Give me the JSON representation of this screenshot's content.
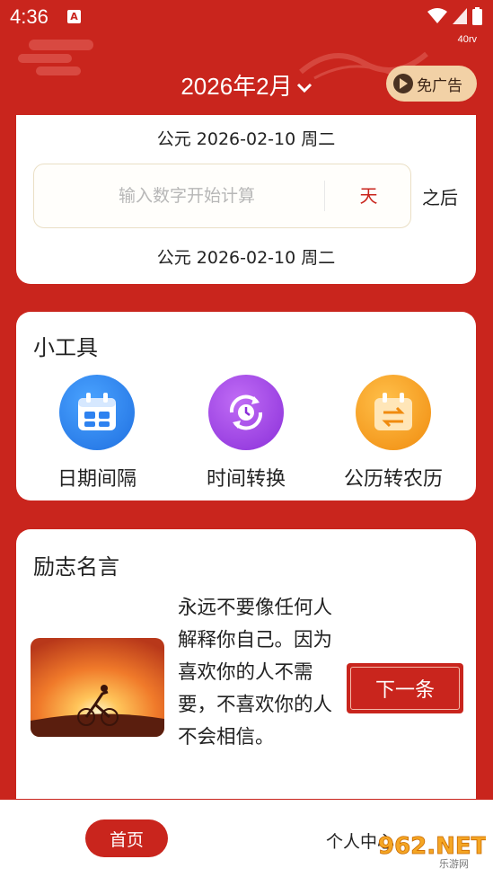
{
  "status_bar": {
    "time": "4:36",
    "app_badge": "A",
    "net_label": "40rv"
  },
  "header": {
    "month_title": "2026年2月",
    "ad_button_label": "免广告"
  },
  "calculator": {
    "date_top": "公元 2026-02-10 周二",
    "input_placeholder": "输入数字开始计算",
    "input_value": "",
    "unit_label": "天",
    "direction_label": "之后",
    "date_bottom": "公元 2026-02-10 周二"
  },
  "tools": {
    "title": "小工具",
    "items": [
      {
        "label": "日期间隔",
        "icon": "calendar-icon",
        "color": "#2e82f0"
      },
      {
        "label": "时间转换",
        "icon": "clock-convert-icon",
        "color": "#9c3ce3"
      },
      {
        "label": "公历转农历",
        "icon": "calendar-swap-icon",
        "color": "#f59a16"
      }
    ]
  },
  "quotes": {
    "title": "励志名言",
    "text": "永远不要像任何人解释你自己。因为喜欢你的人不需要，不喜欢你的人不会相信。",
    "next_label": "下一条",
    "image_icon": "cyclist-sunset-image"
  },
  "bottom_nav": {
    "home_label": "首页",
    "profile_label": "个人中心"
  },
  "watermark": {
    "text": "962.NET",
    "subtext": "乐游网"
  },
  "colors": {
    "primary": "#c9251d",
    "ad_bg": "#f2d1a6"
  }
}
